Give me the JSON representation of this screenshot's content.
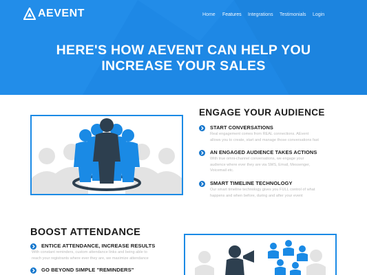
{
  "brand": {
    "name": "AEVENT",
    "logo": "aevent-logo-icon"
  },
  "colors": {
    "primary": "#1e88e5",
    "accent": "#1577cd",
    "muted_text": "#b9b9b9",
    "heading": "#1b1b1b"
  },
  "nav": {
    "items": [
      {
        "label": "Home",
        "active": false
      },
      {
        "label": "Features",
        "active": true
      },
      {
        "label": "Integrations",
        "active": false
      },
      {
        "label": "Testimonials",
        "active": false
      },
      {
        "label": "Login",
        "active": false
      }
    ]
  },
  "hero": {
    "title_line1": "HERE'S HOW AEVENT CAN HELP YOU",
    "title_line2": "INCREASE YOUR SALES"
  },
  "engage": {
    "title": "ENGAGE YOUR AUDIENCE",
    "illustration": "audience-group-icon",
    "items": [
      {
        "heading": "START CONVERSATIONS",
        "lines": [
          "Real engagement comes from REAL connections. AEvent",
          "allows you to create, start and manage those conversations fast"
        ]
      },
      {
        "heading": "AN ENGAGED AUDIENCE TAKES ACTIONS",
        "lines": [
          "With true omni-channel conversations, we engage your",
          "audience where ever they are via SMS, Email, Messenger,",
          "Voicemail etc."
        ]
      },
      {
        "heading": "SMART TIMELINE TECHNOLOGY",
        "lines": [
          "Our smart timeline technology gives you FULL control of what",
          "happens and when before, during and after your event"
        ]
      }
    ]
  },
  "boost": {
    "title": "BOOST ATTENDANCE",
    "illustration": "megaphone-speaker-icon",
    "items": [
      {
        "heading": "ENTICE ATTENDANCE, INCREASE RESULTS",
        "lines": [
          "With constant reminders, custom attendance links and being able to",
          "reach your registrants where ever they are, we maximize attendance"
        ]
      },
      {
        "heading": "GO BEYOND SIMPLE \"REMINDERS\"",
        "lines": []
      }
    ]
  }
}
